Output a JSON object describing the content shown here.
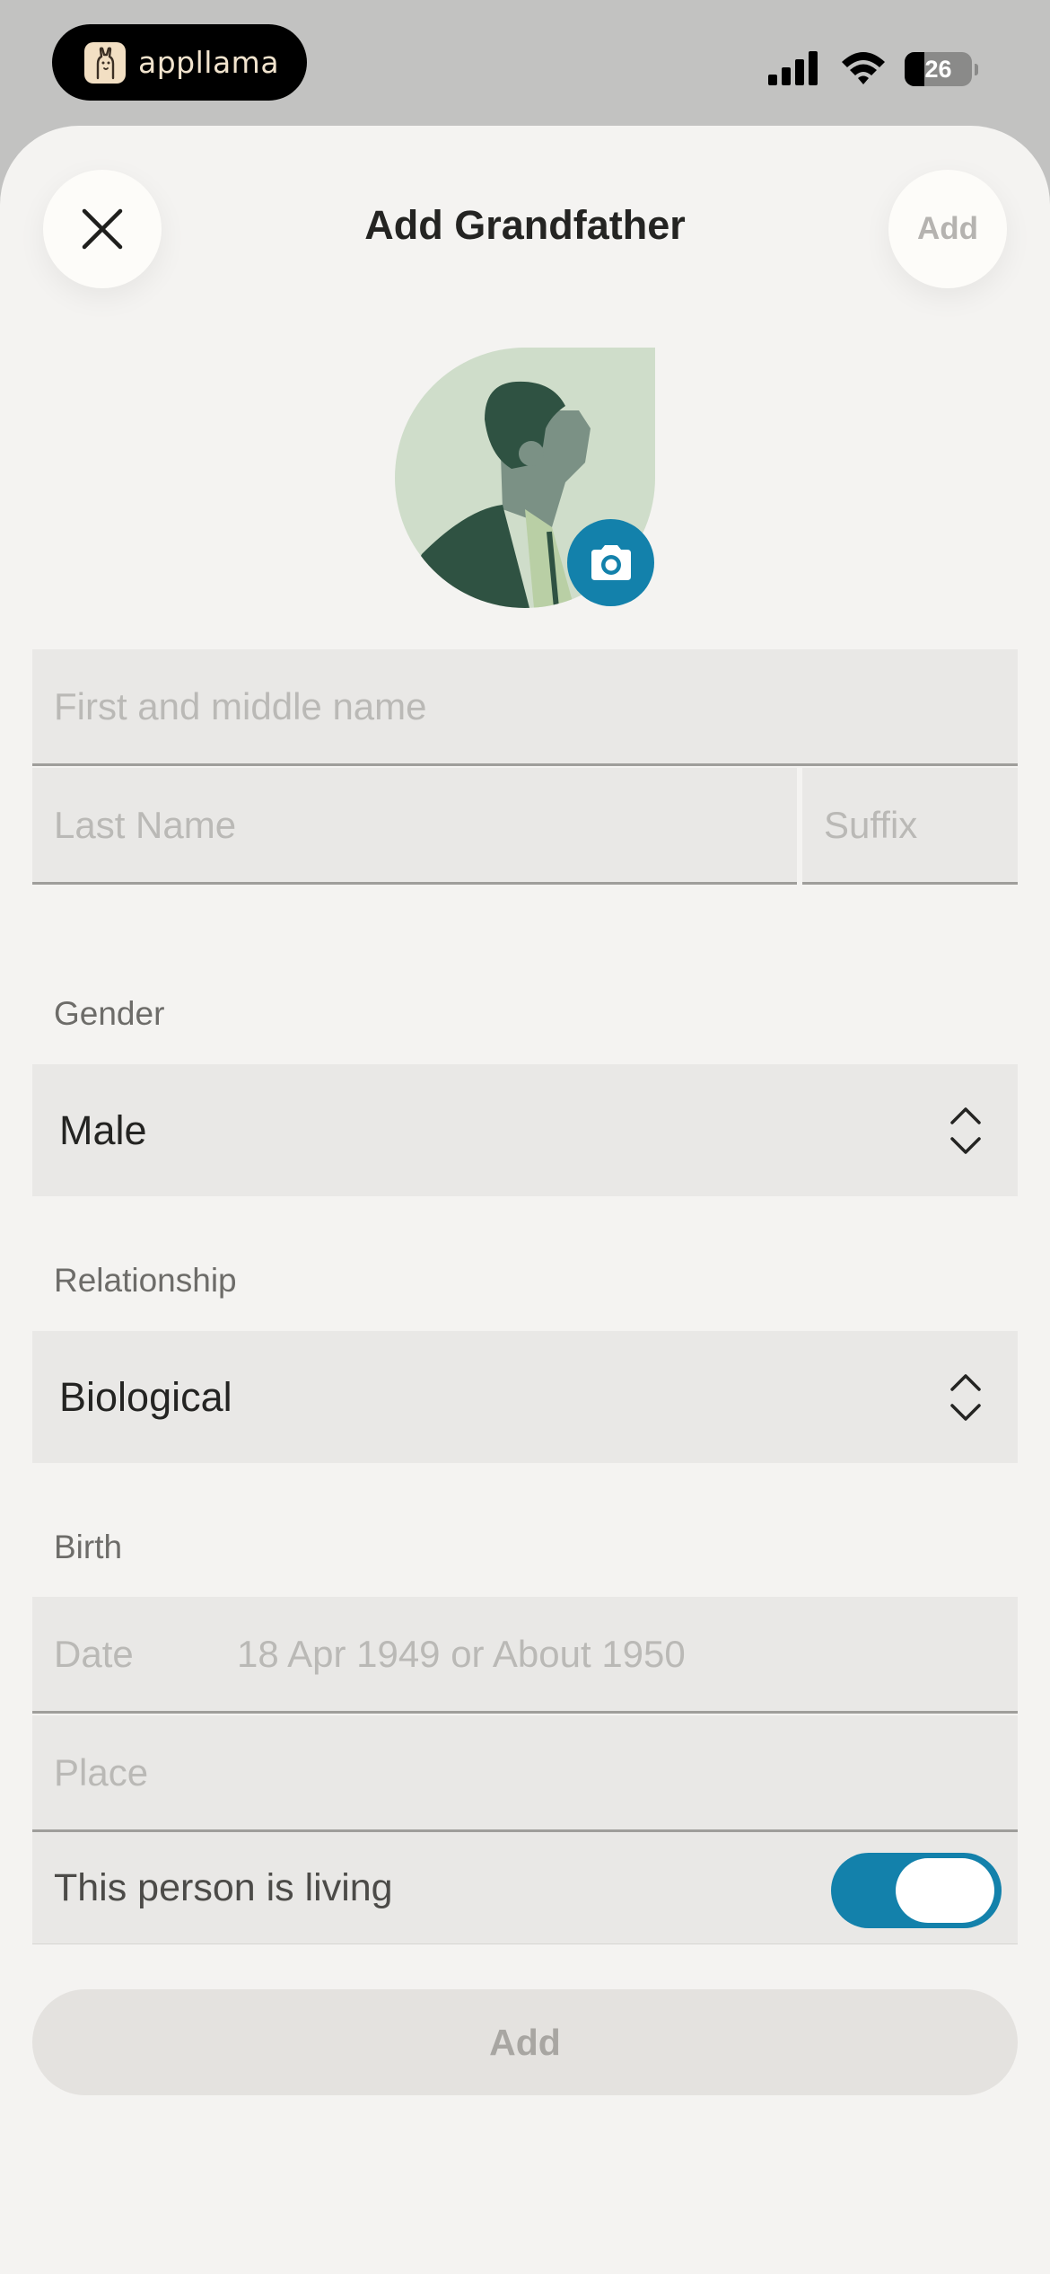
{
  "status_bar": {
    "app_name": "appllama",
    "battery_level": "26",
    "icons": [
      "llama-logo-icon",
      "cellular-signal-icon",
      "wifi-icon",
      "battery-icon"
    ]
  },
  "sheet": {
    "title": "Add Grandfather",
    "close_icon": "close-icon",
    "add_label": "Add"
  },
  "avatar": {
    "camera_icon": "camera-icon"
  },
  "name_fields": {
    "first_placeholder": "First and middle name",
    "first_value": "",
    "last_placeholder": "Last Name",
    "last_value": "",
    "suffix_placeholder": "Suffix",
    "suffix_value": ""
  },
  "gender": {
    "label": "Gender",
    "value": "Male"
  },
  "relationship": {
    "label": "Relationship",
    "value": "Biological"
  },
  "birth": {
    "label": "Birth",
    "date_label": "Date",
    "date_placeholder": "18 Apr 1949 or About 1950",
    "place_placeholder": "Place"
  },
  "living": {
    "label": "This person is living",
    "enabled": true
  },
  "footer": {
    "add_label": "Add"
  },
  "colors": {
    "accent": "#1381ab",
    "sheet_background": "#f4f3f1",
    "field_background": "#e9e8e6",
    "placeholder_text": "#bab9b6",
    "disabled_button": "#e4e2df"
  }
}
